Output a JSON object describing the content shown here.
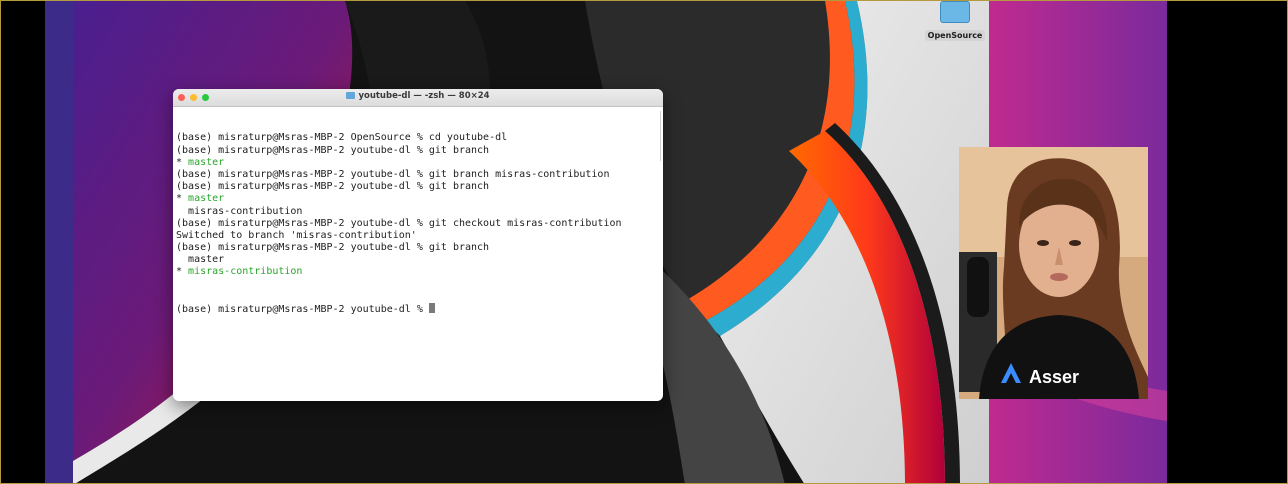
{
  "desktop": {
    "folder_label": "OpenSource"
  },
  "terminal": {
    "title": "youtube-dl — -zsh — 80×24",
    "lines": [
      {
        "prefix": "",
        "text": "(base) misraturp@Msras-MBP-2 OpenSource % cd youtube-dl",
        "green": false
      },
      {
        "prefix": "",
        "text": "(base) misraturp@Msras-MBP-2 youtube-dl % git branch",
        "green": false
      },
      {
        "prefix": "* ",
        "text": "master",
        "green": true
      },
      {
        "prefix": "",
        "text": "(base) misraturp@Msras-MBP-2 youtube-dl % git branch misras-contribution",
        "green": false
      },
      {
        "prefix": "",
        "text": "(base) misraturp@Msras-MBP-2 youtube-dl % git branch",
        "green": false
      },
      {
        "prefix": "* ",
        "text": "master",
        "green": true
      },
      {
        "prefix": "  ",
        "text": "misras-contribution",
        "green": false
      },
      {
        "prefix": "",
        "text": "(base) misraturp@Msras-MBP-2 youtube-dl % git checkout misras-contribution",
        "green": false
      },
      {
        "prefix": "",
        "text": "Switched to branch 'misras-contribution'",
        "green": false
      },
      {
        "prefix": "",
        "text": "(base) misraturp@Msras-MBP-2 youtube-dl % git branch",
        "green": false
      },
      {
        "prefix": "  ",
        "text": "master",
        "green": false
      },
      {
        "prefix": "* ",
        "text": "misras-contribution",
        "green": true
      }
    ],
    "prompt": "(base) misraturp@Msras-MBP-2 youtube-dl % "
  },
  "webcam": {
    "shirt_text": "Asser"
  },
  "colors": {
    "branch_green": "#2aa52a",
    "traffic_red": "#fd5f57",
    "traffic_yellow": "#fdbb2e",
    "traffic_green": "#28c940"
  }
}
